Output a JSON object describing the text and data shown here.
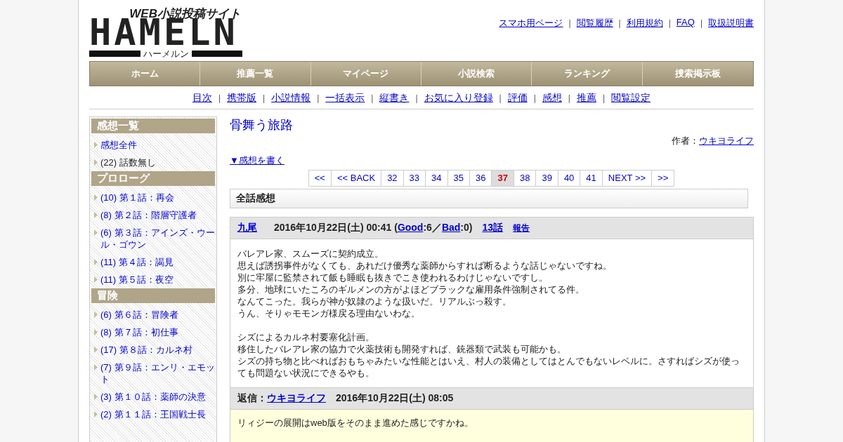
{
  "logo": {
    "tagline": "WEB小説投稿サイト",
    "name": "HAMELN",
    "reading": "ハーメルン"
  },
  "link_separator": "|",
  "header_links": [
    "スマホ用ページ",
    "閲覧履歴",
    "利用規約",
    "FAQ",
    "取扱説明書"
  ],
  "nav": [
    "ホーム",
    "推薦一覧",
    "マイページ",
    "小説検索",
    "ランキング",
    "捜索掲示板"
  ],
  "sub_nav": [
    "目次",
    "携帯版",
    "小説情報",
    "一括表示",
    "縦書き",
    "お気に入り登録",
    "評価",
    "感想",
    "推薦",
    "閲覧設定"
  ],
  "sidebar": [
    {
      "title": "感想一覧",
      "items": [
        {
          "text": "感想全件",
          "kind": "link"
        },
        {
          "text": "(22) 話数無し",
          "kind": "plain"
        }
      ]
    },
    {
      "title": "プロローグ",
      "items": [
        {
          "text": "(10) 第１話：再会",
          "kind": "link"
        },
        {
          "text": "(8) 第２話：階層守護者",
          "kind": "link"
        },
        {
          "text": "(6) 第３話：アインズ・ウール・ゴウン",
          "kind": "link"
        },
        {
          "text": "(11) 第４話：謁見",
          "kind": "link"
        },
        {
          "text": "(11) 第５話：夜空",
          "kind": "link"
        }
      ]
    },
    {
      "title": "冒険",
      "items": [
        {
          "text": "(6) 第６話：冒険者",
          "kind": "link"
        },
        {
          "text": "(8) 第７話：初仕事",
          "kind": "link"
        },
        {
          "text": "(17) 第８話：カルネ村",
          "kind": "link"
        },
        {
          "text": "(7) 第９話：エンリ・エモット",
          "kind": "link"
        },
        {
          "text": "(3) 第１０話：薬師の決意",
          "kind": "link"
        },
        {
          "text": "(2) 第１１話：王国戦士長",
          "kind": "link"
        }
      ]
    }
  ],
  "novel_title": "骨舞う旅路",
  "author_label": "作者：",
  "author": "ウキヨライフ",
  "write_link": "▼感想を書く",
  "pagination": [
    {
      "label": "<<",
      "selected": false
    },
    {
      "label": "<< BACK",
      "selected": false
    },
    {
      "label": "32",
      "selected": false
    },
    {
      "label": "33",
      "selected": false
    },
    {
      "label": "34",
      "selected": false
    },
    {
      "label": "35",
      "selected": false
    },
    {
      "label": "36",
      "selected": false
    },
    {
      "label": "37",
      "selected": true
    },
    {
      "label": "38",
      "selected": false
    },
    {
      "label": "39",
      "selected": false
    },
    {
      "label": "40",
      "selected": false
    },
    {
      "label": "41",
      "selected": false
    },
    {
      "label": "NEXT >>",
      "selected": false
    },
    {
      "label": ">>",
      "selected": false
    }
  ],
  "section_title": "全話感想",
  "comment": {
    "author": "九尾",
    "date": "2016年10月22日(土) 00:41",
    "votes": [
      {
        "text": "(",
        "kind": "plain"
      },
      {
        "text": "Good",
        "kind": "link"
      },
      {
        "text": ":6／",
        "kind": "plain"
      },
      {
        "text": "Bad",
        "kind": "link"
      },
      {
        "text": ":0)",
        "kind": "plain"
      }
    ],
    "episode": "13話",
    "report": "報告",
    "paragraphs": [
      [
        "バレアレ家、スムーズに契約成立。",
        "思えば誘拐事件がなくても、あれだけ優秀な薬師からすれば断るような話じゃないですね。",
        "別に牢屋に監禁されて飯も睡眠も抜きでこき使われるわけじゃないですし。",
        "多分、地球にいたころのギルメンの方がよほどブラックな雇用条件強制されてる件。",
        "なんてこった。我らが神が奴隷のような扱いだ。リアルぶっ殺す。",
        "うん、そりゃモモンガ様戻る理由ないわな。"
      ],
      [
        "シズによるカルネ村要塞化計画。",
        "移住したバレアレ家の協力で火薬技術も開発すれば、銃器類で武装も可能かも。",
        "シズの持ち物と比べればおもちゃみたいな性能とはいえ、村人の装備としてはとんでもないレベルに。さすればシズが使っても問題ない状況にできるやも。"
      ]
    ],
    "reply": {
      "label": "返信：",
      "author": "ウキヨライフ",
      "date": "2016年10月22日(土) 08:05",
      "body": "リィジーの展開はweb版をそのまま進めた感じですかね。"
    }
  }
}
